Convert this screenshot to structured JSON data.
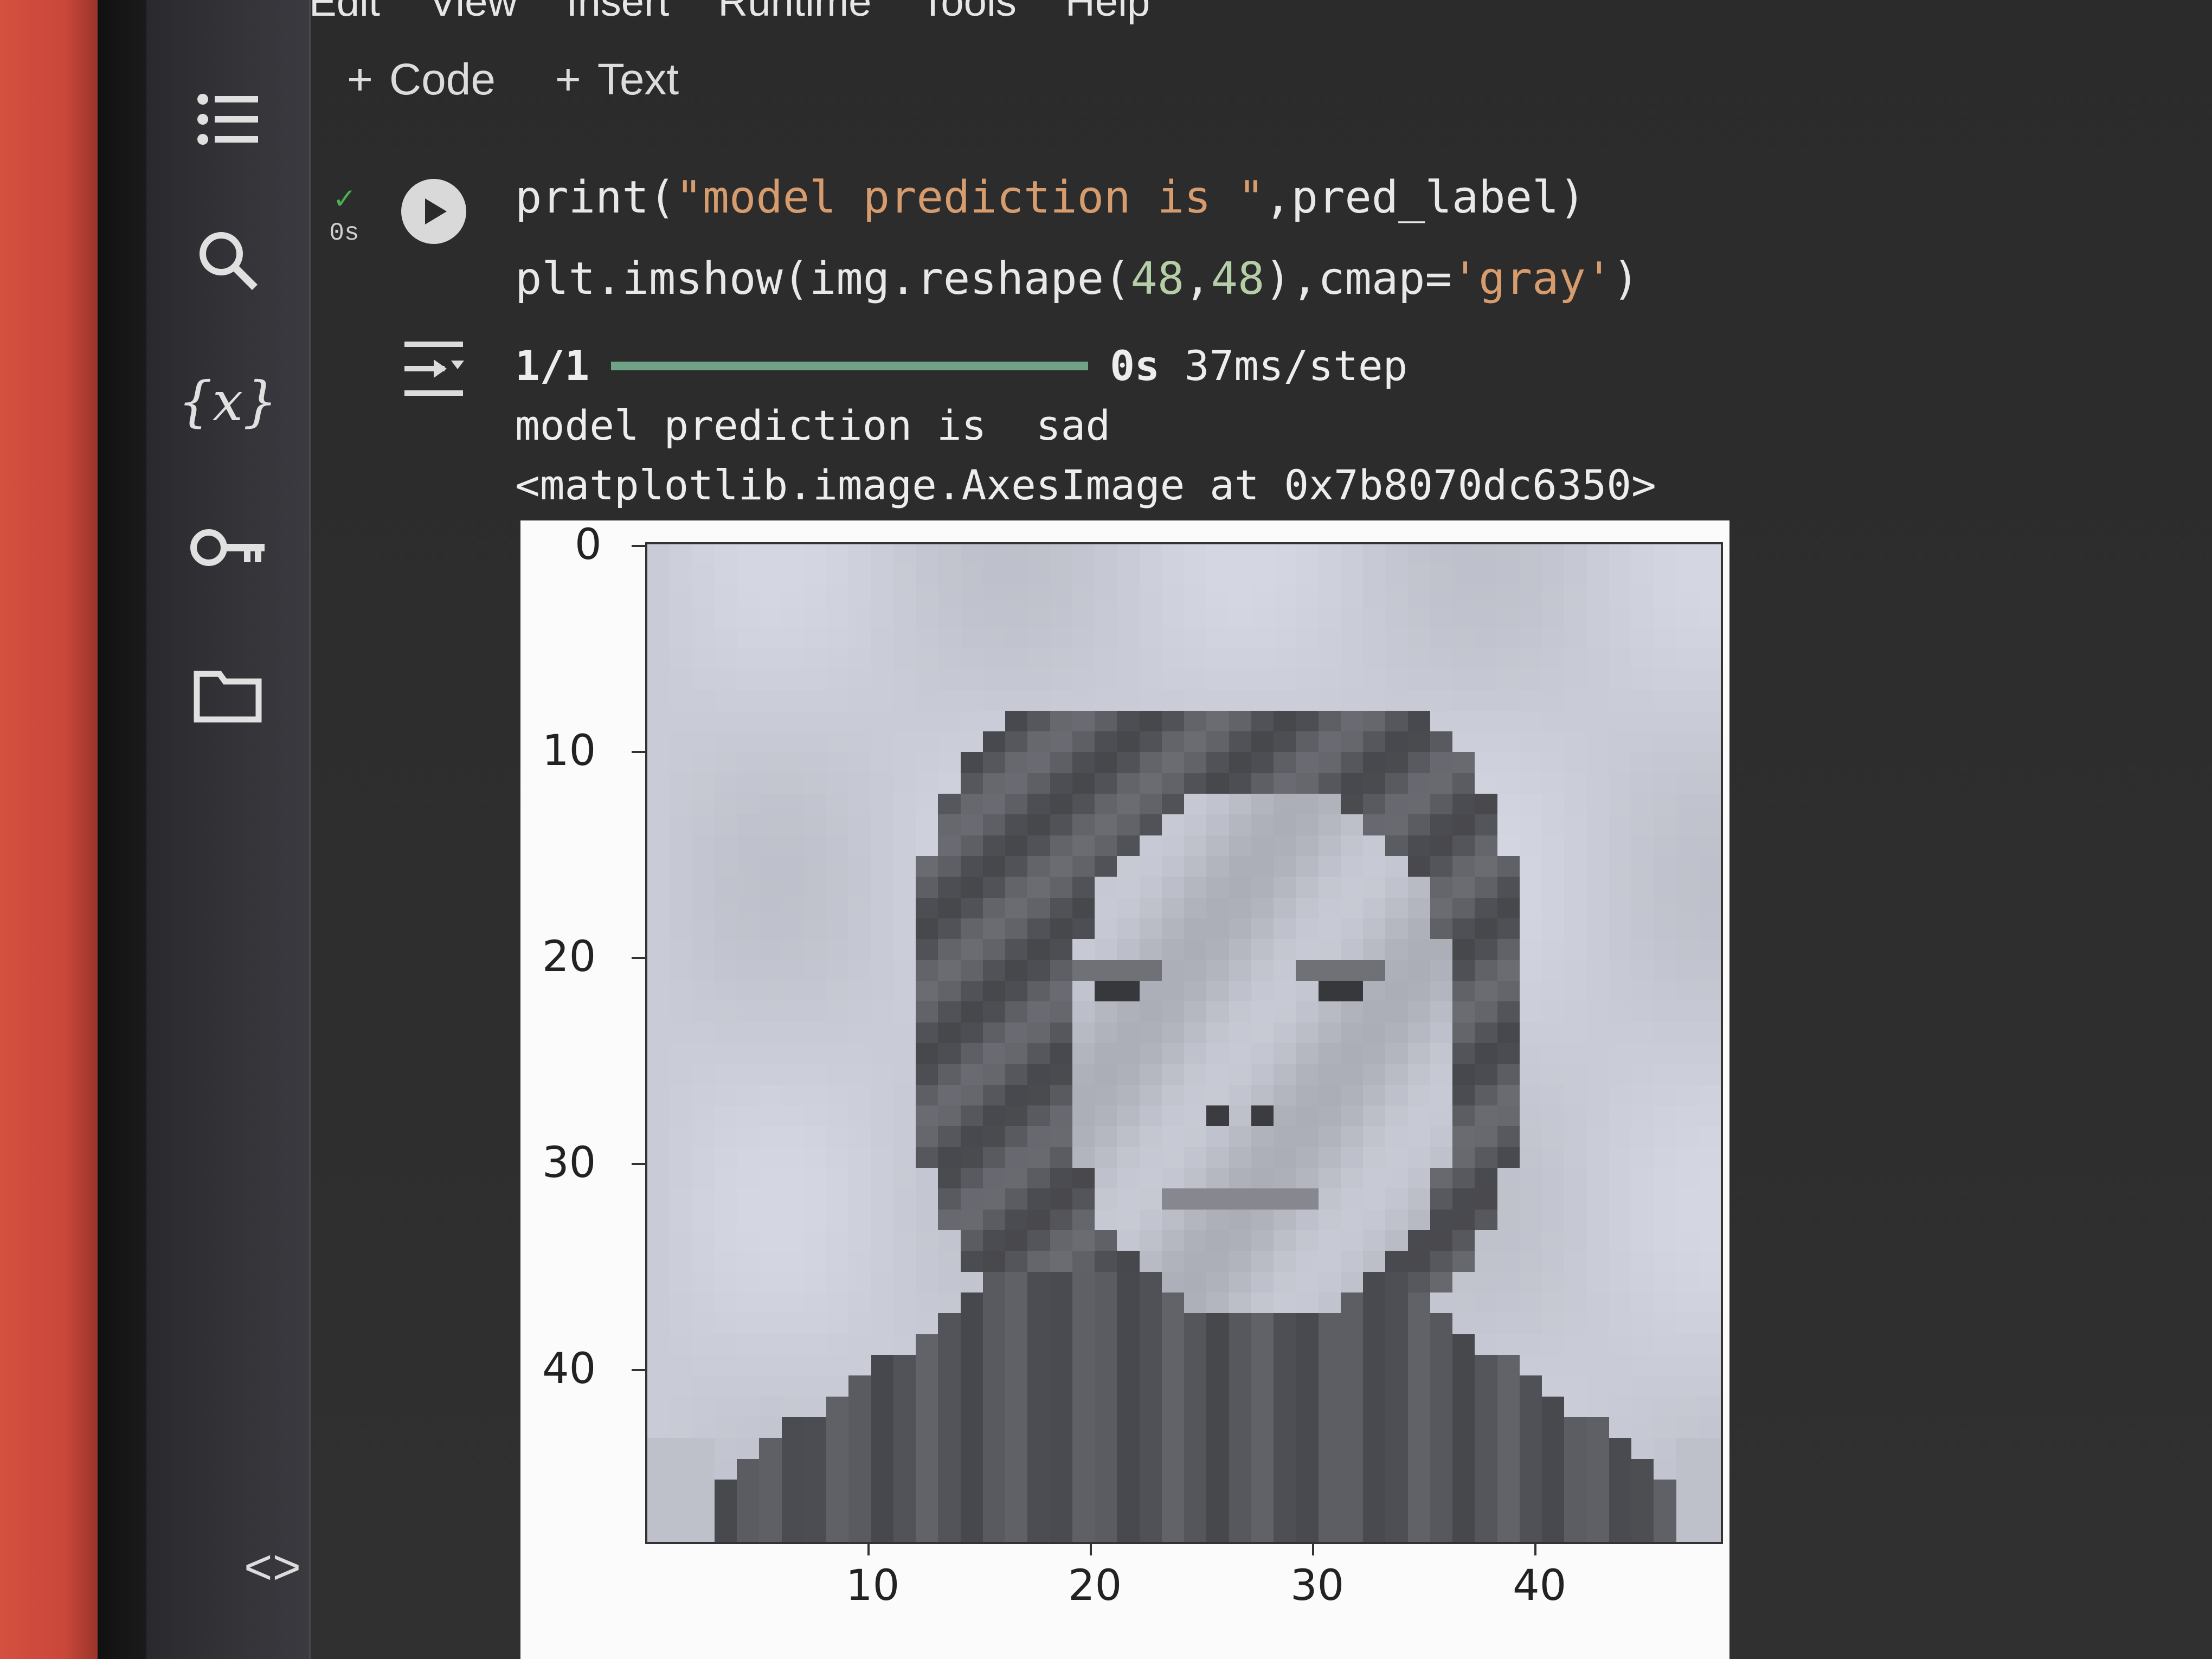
{
  "menu": {
    "items": [
      "Edit",
      "View",
      "Insert",
      "Runtime",
      "Tools",
      "Help"
    ]
  },
  "toolbar": {
    "code_label": "Code",
    "text_label": "Text"
  },
  "rail": {
    "icons": [
      "table-of-contents-icon",
      "search-icon",
      "variables-icon",
      "secrets-key-icon",
      "files-folder-icon"
    ],
    "bottom_icon": "code-snippets-icon"
  },
  "cell": {
    "exec_time": "0s",
    "code_line1_a": "print(",
    "code_line1_str": "\"model prediction is \"",
    "code_line1_b": ",pred_label)",
    "code_line2_a": "plt.imshow(img.reshape(",
    "code_line2_n1": "48",
    "code_line2_comma": ",",
    "code_line2_n2": "48",
    "code_line2_b": "),cmap=",
    "code_line2_str": "'gray'",
    "code_line2_c": ")"
  },
  "output": {
    "step": "1/1",
    "progress": 1.0,
    "time": "0s",
    "per_step": "37ms/step",
    "prediction_line": "model prediction is  sad",
    "repr_line": "<matplotlib.image.AxesImage at 0x7b8070dc6350>"
  },
  "plot": {
    "y_ticks": [
      "0",
      "10",
      "20",
      "30",
      "40"
    ],
    "x_ticks": [
      "10",
      "20",
      "30",
      "40"
    ]
  },
  "colors": {
    "accent_green": "#4caf50",
    "progress_green": "#6fa387",
    "string_orange": "#d79c6e"
  }
}
